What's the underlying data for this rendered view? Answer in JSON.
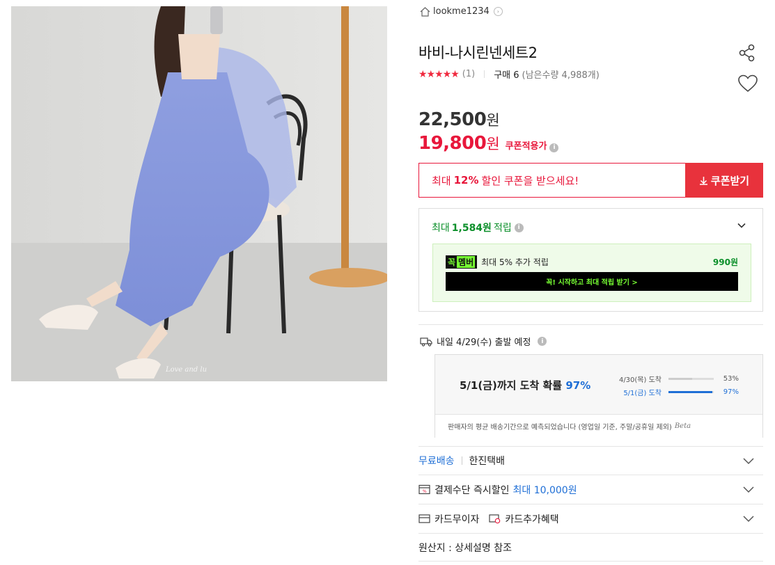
{
  "seller": {
    "name": "lookme1234"
  },
  "product": {
    "title": "바비-나시린넨세트2",
    "stars": "★★★★★",
    "review_count": "(1)",
    "buy_count": "구매 6",
    "remaining": "(남은수량 4,988개)",
    "image_watermark": "Love and lu"
  },
  "price": {
    "original": "22,500",
    "original_unit": "원",
    "sale": "19,800",
    "sale_unit": "원",
    "sale_tag": "쿠폰적용가"
  },
  "coupon": {
    "prefix": "최대",
    "percent": "12%",
    "suffix": "할인 쿠폰을 받으세요!",
    "button_label": "쿠폰받기"
  },
  "points": {
    "prefix": "최대",
    "amount": "1,584원",
    "suffix": "적립",
    "member_logo_a": "꼭",
    "member_logo_b": "멤버",
    "member_text": "최대 5% 추가 적립",
    "member_amount": "990원",
    "member_cta": "꼭! 시작하고 최대 적립 받기 >"
  },
  "shipping": {
    "depart_text": "내일 4/29(수) 출발 예정",
    "eta_prefix": "5/1(금)까지 도착 확률",
    "eta_percent": "97%",
    "rows": [
      {
        "label": "4/30(목) 도착",
        "value": "53%",
        "fraction": 0.53
      },
      {
        "label": "5/1(금) 도착",
        "value": "97%",
        "fraction": 0.97
      }
    ],
    "footnote": "판매자의 평균 배송기간으로 예측되었습니다 (영업일 기준, 주말/공휴일 제외)",
    "beta": "Beta"
  },
  "rows": {
    "free_ship": "무료배송",
    "courier": "한진택배",
    "pay_discount": "결제수단 즉시할인",
    "pay_discount_max": "최대 10,000원",
    "card_noint": "카드무이자",
    "card_benefit": "카드추가혜택",
    "origin": "원산지 : 상세설명 참조"
  },
  "colors": {
    "accent_red": "#e8173b",
    "coupon_btn": "#e8323c",
    "point_green": "#0b8f2a",
    "eta_blue": "#1f6fd6",
    "member_green": "#77ff33"
  }
}
